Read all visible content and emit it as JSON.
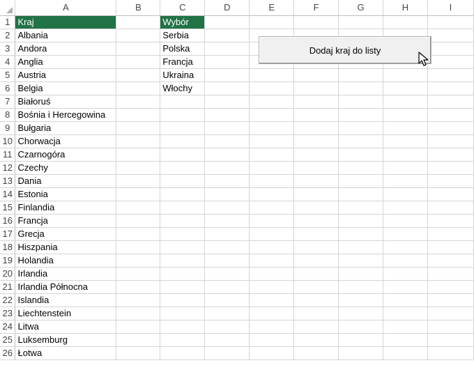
{
  "columns": [
    "A",
    "B",
    "C",
    "D",
    "E",
    "F",
    "G",
    "H",
    "I"
  ],
  "rows": [
    {
      "num": "1",
      "a": "Kraj",
      "c": "Wybór"
    },
    {
      "num": "2",
      "a": "Albania",
      "c": "Serbia"
    },
    {
      "num": "3",
      "a": "Andora",
      "c": "Polska"
    },
    {
      "num": "4",
      "a": "Anglia",
      "c": "Francja"
    },
    {
      "num": "5",
      "a": "Austria",
      "c": "Ukraina"
    },
    {
      "num": "6",
      "a": "Belgia",
      "c": "Włochy"
    },
    {
      "num": "7",
      "a": "Białoruś",
      "c": ""
    },
    {
      "num": "8",
      "a": "Bośnia i Hercegowina",
      "c": ""
    },
    {
      "num": "9",
      "a": "Bułgaria",
      "c": ""
    },
    {
      "num": "10",
      "a": "Chorwacja",
      "c": ""
    },
    {
      "num": "11",
      "a": "Czarnogóra",
      "c": ""
    },
    {
      "num": "12",
      "a": "Czechy",
      "c": ""
    },
    {
      "num": "13",
      "a": "Dania",
      "c": ""
    },
    {
      "num": "14",
      "a": "Estonia",
      "c": ""
    },
    {
      "num": "15",
      "a": "Finlandia",
      "c": ""
    },
    {
      "num": "16",
      "a": "Francja",
      "c": ""
    },
    {
      "num": "17",
      "a": "Grecja",
      "c": ""
    },
    {
      "num": "18",
      "a": "Hiszpania",
      "c": ""
    },
    {
      "num": "19",
      "a": "Holandia",
      "c": ""
    },
    {
      "num": "20",
      "a": "Irlandia",
      "c": ""
    },
    {
      "num": "21",
      "a": "Irlandia Północna",
      "c": ""
    },
    {
      "num": "22",
      "a": "Islandia",
      "c": ""
    },
    {
      "num": "23",
      "a": "Liechtenstein",
      "c": ""
    },
    {
      "num": "24",
      "a": "Litwa",
      "c": ""
    },
    {
      "num": "25",
      "a": "Luksemburg",
      "c": ""
    },
    {
      "num": "26",
      "a": "Łotwa",
      "c": ""
    }
  ],
  "button": {
    "label": "Dodaj kraj do listy"
  },
  "colors": {
    "header_fill": "#217346",
    "grid_line": "#d4d4d4"
  },
  "icons": {
    "cursor": "mouse-pointer-icon",
    "corner": "select-all-triangle-icon"
  }
}
